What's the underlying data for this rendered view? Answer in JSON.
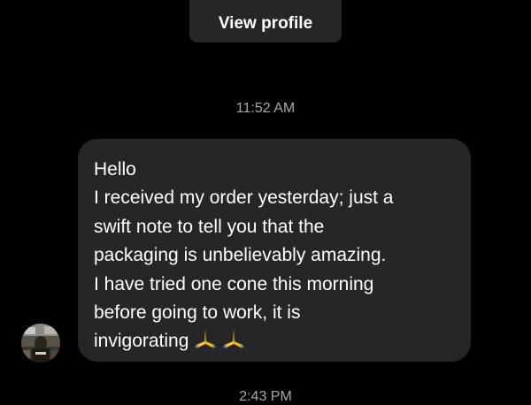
{
  "header": {
    "view_profile_label": "View profile"
  },
  "thread": {
    "timestamp_1": "11:52 AM",
    "timestamp_2": "2:43 PM",
    "message": {
      "lines": [
        "Hello",
        "I received my order yesterday; just a",
        "swift note to tell you that the",
        "packaging is unbelievably amazing.",
        "I have tried one cone this morning",
        "before going to work, it is",
        "invigorating"
      ],
      "emoji": [
        "folded-hands-icon",
        "folded-hands-icon"
      ]
    }
  },
  "colors": {
    "background": "#000000",
    "bubble": "#262626",
    "button": "#262626",
    "timestamp": "#a8a8a8",
    "text": "#ffffff"
  }
}
